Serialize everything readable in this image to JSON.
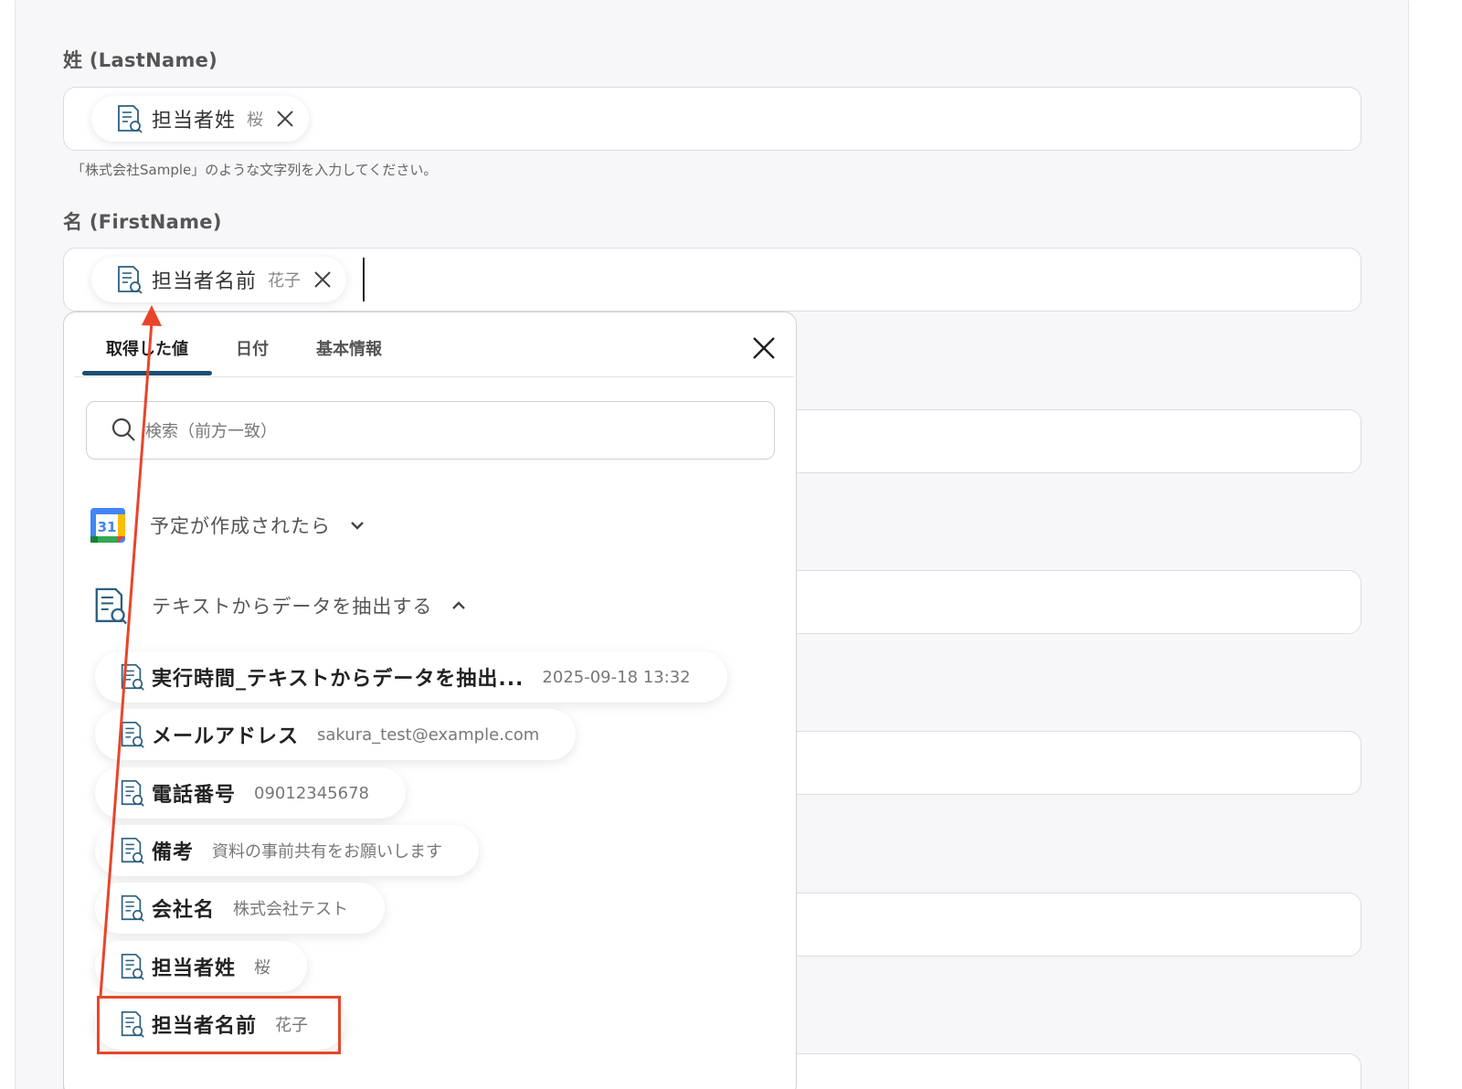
{
  "form": {
    "lastname_label": "姓 (LastName)",
    "lastname_chip": {
      "name": "担当者姓",
      "value": "桜"
    },
    "lastname_hint": "「株式会社Sample」のような文字列を入力してください。",
    "firstname_label": "名 (FirstName)",
    "firstname_chip": {
      "name": "担当者名前",
      "value": "花子"
    }
  },
  "dropdown": {
    "tabs": [
      {
        "label": "取得した値",
        "active": true
      },
      {
        "label": "日付",
        "active": false
      },
      {
        "label": "基本情報",
        "active": false
      }
    ],
    "search_placeholder": "検索（前方一致）",
    "groups": [
      {
        "name": "予定が作成されたら",
        "expanded": false,
        "icon": "google-calendar-icon",
        "icon_text": "31"
      },
      {
        "name": "テキストからデータを抽出する",
        "expanded": true,
        "icon": "document-search-icon"
      }
    ],
    "items": [
      {
        "name": "実行時間_テキストからデータを抽出...",
        "value": "2025-09-18 13:32"
      },
      {
        "name": "メールアドレス",
        "value": "sakura_test@example.com"
      },
      {
        "name": "電話番号",
        "value": "09012345678"
      },
      {
        "name": "備考",
        "value": "資料の事前共有をお願いします"
      },
      {
        "name": "会社名",
        "value": "株式会社テスト"
      },
      {
        "name": "担当者姓",
        "value": "桜"
      },
      {
        "name": "担当者名前",
        "value": "花子"
      }
    ]
  },
  "colors": {
    "accent": "#1b4f72",
    "annotation": "#e8452a",
    "icon": "#2b5f7f"
  }
}
